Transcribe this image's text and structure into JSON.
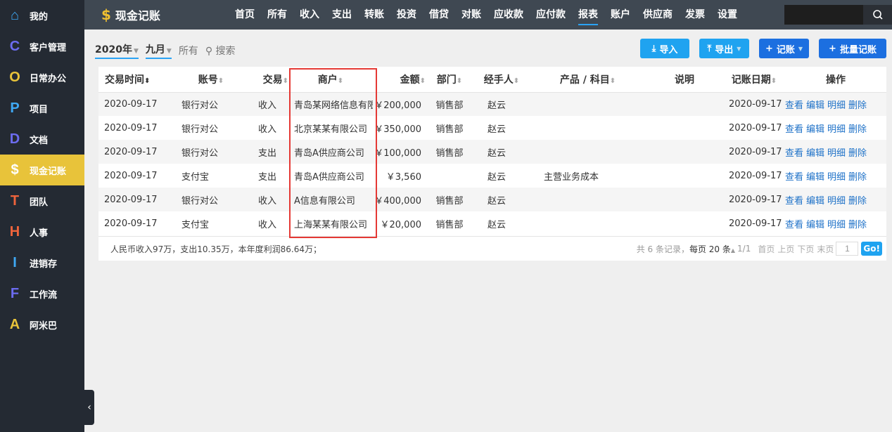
{
  "sidebar": {
    "items": [
      {
        "icon": "⌂",
        "label": "我的",
        "color": "#3fa9f5"
      },
      {
        "icon": "C",
        "label": "客户管理",
        "color": "#6c6cf0"
      },
      {
        "icon": "O",
        "label": "日常办公",
        "color": "#e8c33a"
      },
      {
        "icon": "P",
        "label": "项目",
        "color": "#3fa9f5"
      },
      {
        "icon": "D",
        "label": "文档",
        "color": "#6c6cf0"
      },
      {
        "icon": "$",
        "label": "现金记账",
        "color": "#ffffff"
      },
      {
        "icon": "T",
        "label": "团队",
        "color": "#f0643c"
      },
      {
        "icon": "H",
        "label": "人事",
        "color": "#f0643c"
      },
      {
        "icon": "I",
        "label": "进销存",
        "color": "#3fa9f5"
      },
      {
        "icon": "F",
        "label": "工作流",
        "color": "#6c6cf0"
      },
      {
        "icon": "A",
        "label": "阿米巴",
        "color": "#e8c33a"
      }
    ]
  },
  "header": {
    "title": "现金记账",
    "nav": [
      "首页",
      "所有",
      "收入",
      "支出",
      "转账",
      "投资",
      "借贷",
      "对账",
      "应收款",
      "应付款",
      "报表",
      "账户",
      "供应商",
      "发票",
      "设置"
    ],
    "active": "报表"
  },
  "filters": {
    "year": "2020年",
    "month": "九月",
    "all": "所有",
    "search": "搜索"
  },
  "buttons": {
    "import": "导入",
    "export": "导出",
    "record": "记账",
    "batch": "批量记账"
  },
  "table": {
    "headers": [
      "交易时间",
      "账号",
      "交易",
      "商户",
      "金额",
      "部门",
      "经手人",
      "产品 / 科目",
      "说明",
      "记账日期",
      "操作"
    ],
    "rows": [
      [
        "2020-09-17",
        "银行对公",
        "收入",
        "青岛某网络信息有限",
        "￥200,000",
        "销售部",
        "赵云",
        "",
        "",
        "2020-09-17"
      ],
      [
        "2020-09-17",
        "银行对公",
        "收入",
        "北京某某有限公司",
        "￥350,000",
        "销售部",
        "赵云",
        "",
        "",
        "2020-09-17"
      ],
      [
        "2020-09-17",
        "银行对公",
        "支出",
        "青岛A供应商公司",
        "￥100,000",
        "销售部",
        "赵云",
        "",
        "",
        "2020-09-17"
      ],
      [
        "2020-09-17",
        "支付宝",
        "支出",
        "青岛A供应商公司",
        "￥3,560",
        "赵云",
        "",
        "主营业务成本",
        "",
        "2020-09-17"
      ],
      [
        "2020-09-17",
        "银行对公",
        "收入",
        "A信息有限公司",
        "￥400,000",
        "销售部",
        "赵云",
        "",
        "",
        "2020-09-17"
      ],
      [
        "2020-09-17",
        "支付宝",
        "收入",
        "上海某某有限公司",
        "￥20,000",
        "销售部",
        "赵云",
        "",
        "",
        "2020-09-17"
      ]
    ],
    "actions": [
      "查看",
      "编辑",
      "明细",
      "删除"
    ]
  },
  "footer": {
    "summary": "人民币收入97万，支出10.35万，本年度利润86.64万；",
    "total": "共 6 条记录，",
    "per_page": "每页 20 条",
    "pages": "1/1",
    "first": "首页",
    "prev": "上页",
    "next": "下页",
    "last": "末页",
    "page_value": "1",
    "go": "Go!"
  }
}
